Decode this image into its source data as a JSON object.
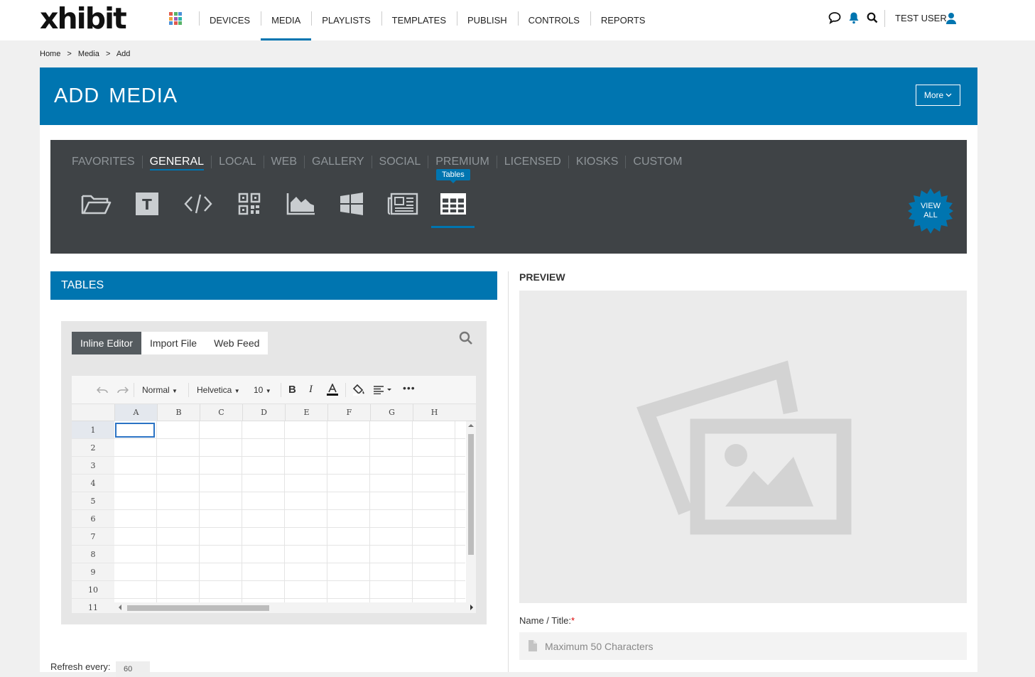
{
  "brand": {
    "logo": "xhibit",
    "accent": "#0075b0"
  },
  "nav": {
    "items": [
      {
        "label": "DEVICES",
        "active": false
      },
      {
        "label": "MEDIA",
        "active": true
      },
      {
        "label": "PLAYLISTS",
        "active": false
      },
      {
        "label": "TEMPLATES",
        "active": false
      },
      {
        "label": "PUBLISH",
        "active": false
      },
      {
        "label": "CONTROLS",
        "active": false
      },
      {
        "label": "REPORTS",
        "active": false
      }
    ],
    "icons": [
      "chat-icon",
      "bell-icon",
      "search-icon"
    ],
    "user": "TEST USER"
  },
  "breadcrumb": [
    "Home",
    ">",
    "Media",
    ">",
    "Add"
  ],
  "page": {
    "title": "ADD MEDIA",
    "more_label": "More"
  },
  "categories": [
    {
      "label": "FAVORITES",
      "active": false
    },
    {
      "label": "GENERAL",
      "active": true
    },
    {
      "label": "LOCAL",
      "active": false
    },
    {
      "label": "WEB",
      "active": false
    },
    {
      "label": "GALLERY",
      "active": false
    },
    {
      "label": "SOCIAL",
      "active": false
    },
    {
      "label": "PREMIUM",
      "active": false
    },
    {
      "label": "LICENSED",
      "active": false
    },
    {
      "label": "KIOSKS",
      "active": false
    },
    {
      "label": "CUSTOM",
      "active": false
    }
  ],
  "media_types": [
    "folder-icon",
    "text-icon",
    "code-icon",
    "qr-code-icon",
    "chart-icon",
    "windows-icon",
    "news-icon",
    "table-icon"
  ],
  "tooltip": "Tables",
  "view_all": {
    "line1": "VIEW",
    "line2": "ALL"
  },
  "section": {
    "title": "TABLES"
  },
  "editor": {
    "tabs": [
      {
        "label": "Inline Editor",
        "active": true
      },
      {
        "label": "Import File",
        "active": false
      },
      {
        "label": "Web Feed",
        "active": false
      }
    ],
    "toolbar": {
      "style": "Normal",
      "font": "Helvetica",
      "size": "10"
    },
    "columns": [
      "A",
      "B",
      "C",
      "D",
      "E",
      "F",
      "G",
      "H"
    ],
    "rows": [
      "1",
      "2",
      "3",
      "4",
      "5",
      "6",
      "7",
      "8",
      "9",
      "10",
      "11"
    ]
  },
  "refresh": {
    "label": "Refresh every:",
    "value": "60"
  },
  "preview": {
    "label": "PREVIEW"
  },
  "name_field": {
    "label": "Name / Title:",
    "required": "*",
    "placeholder": "Maximum 50 Characters"
  }
}
